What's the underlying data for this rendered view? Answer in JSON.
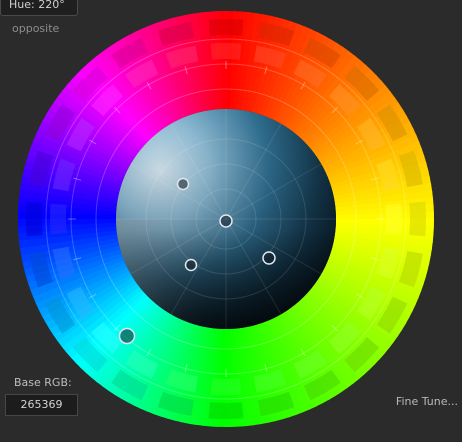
{
  "hue": {
    "label": "Hue: 220°",
    "degrees": 220
  },
  "scheme": {
    "label": "opposite"
  },
  "base_rgb": {
    "label": "Base RGB:",
    "value": "265369"
  },
  "fine_tune": {
    "label": "Fine Tune..."
  },
  "colors": {
    "background": "#2b2b2b",
    "base": "#265369"
  },
  "icons": [
    "color-wheel",
    "color-picker-handle"
  ]
}
